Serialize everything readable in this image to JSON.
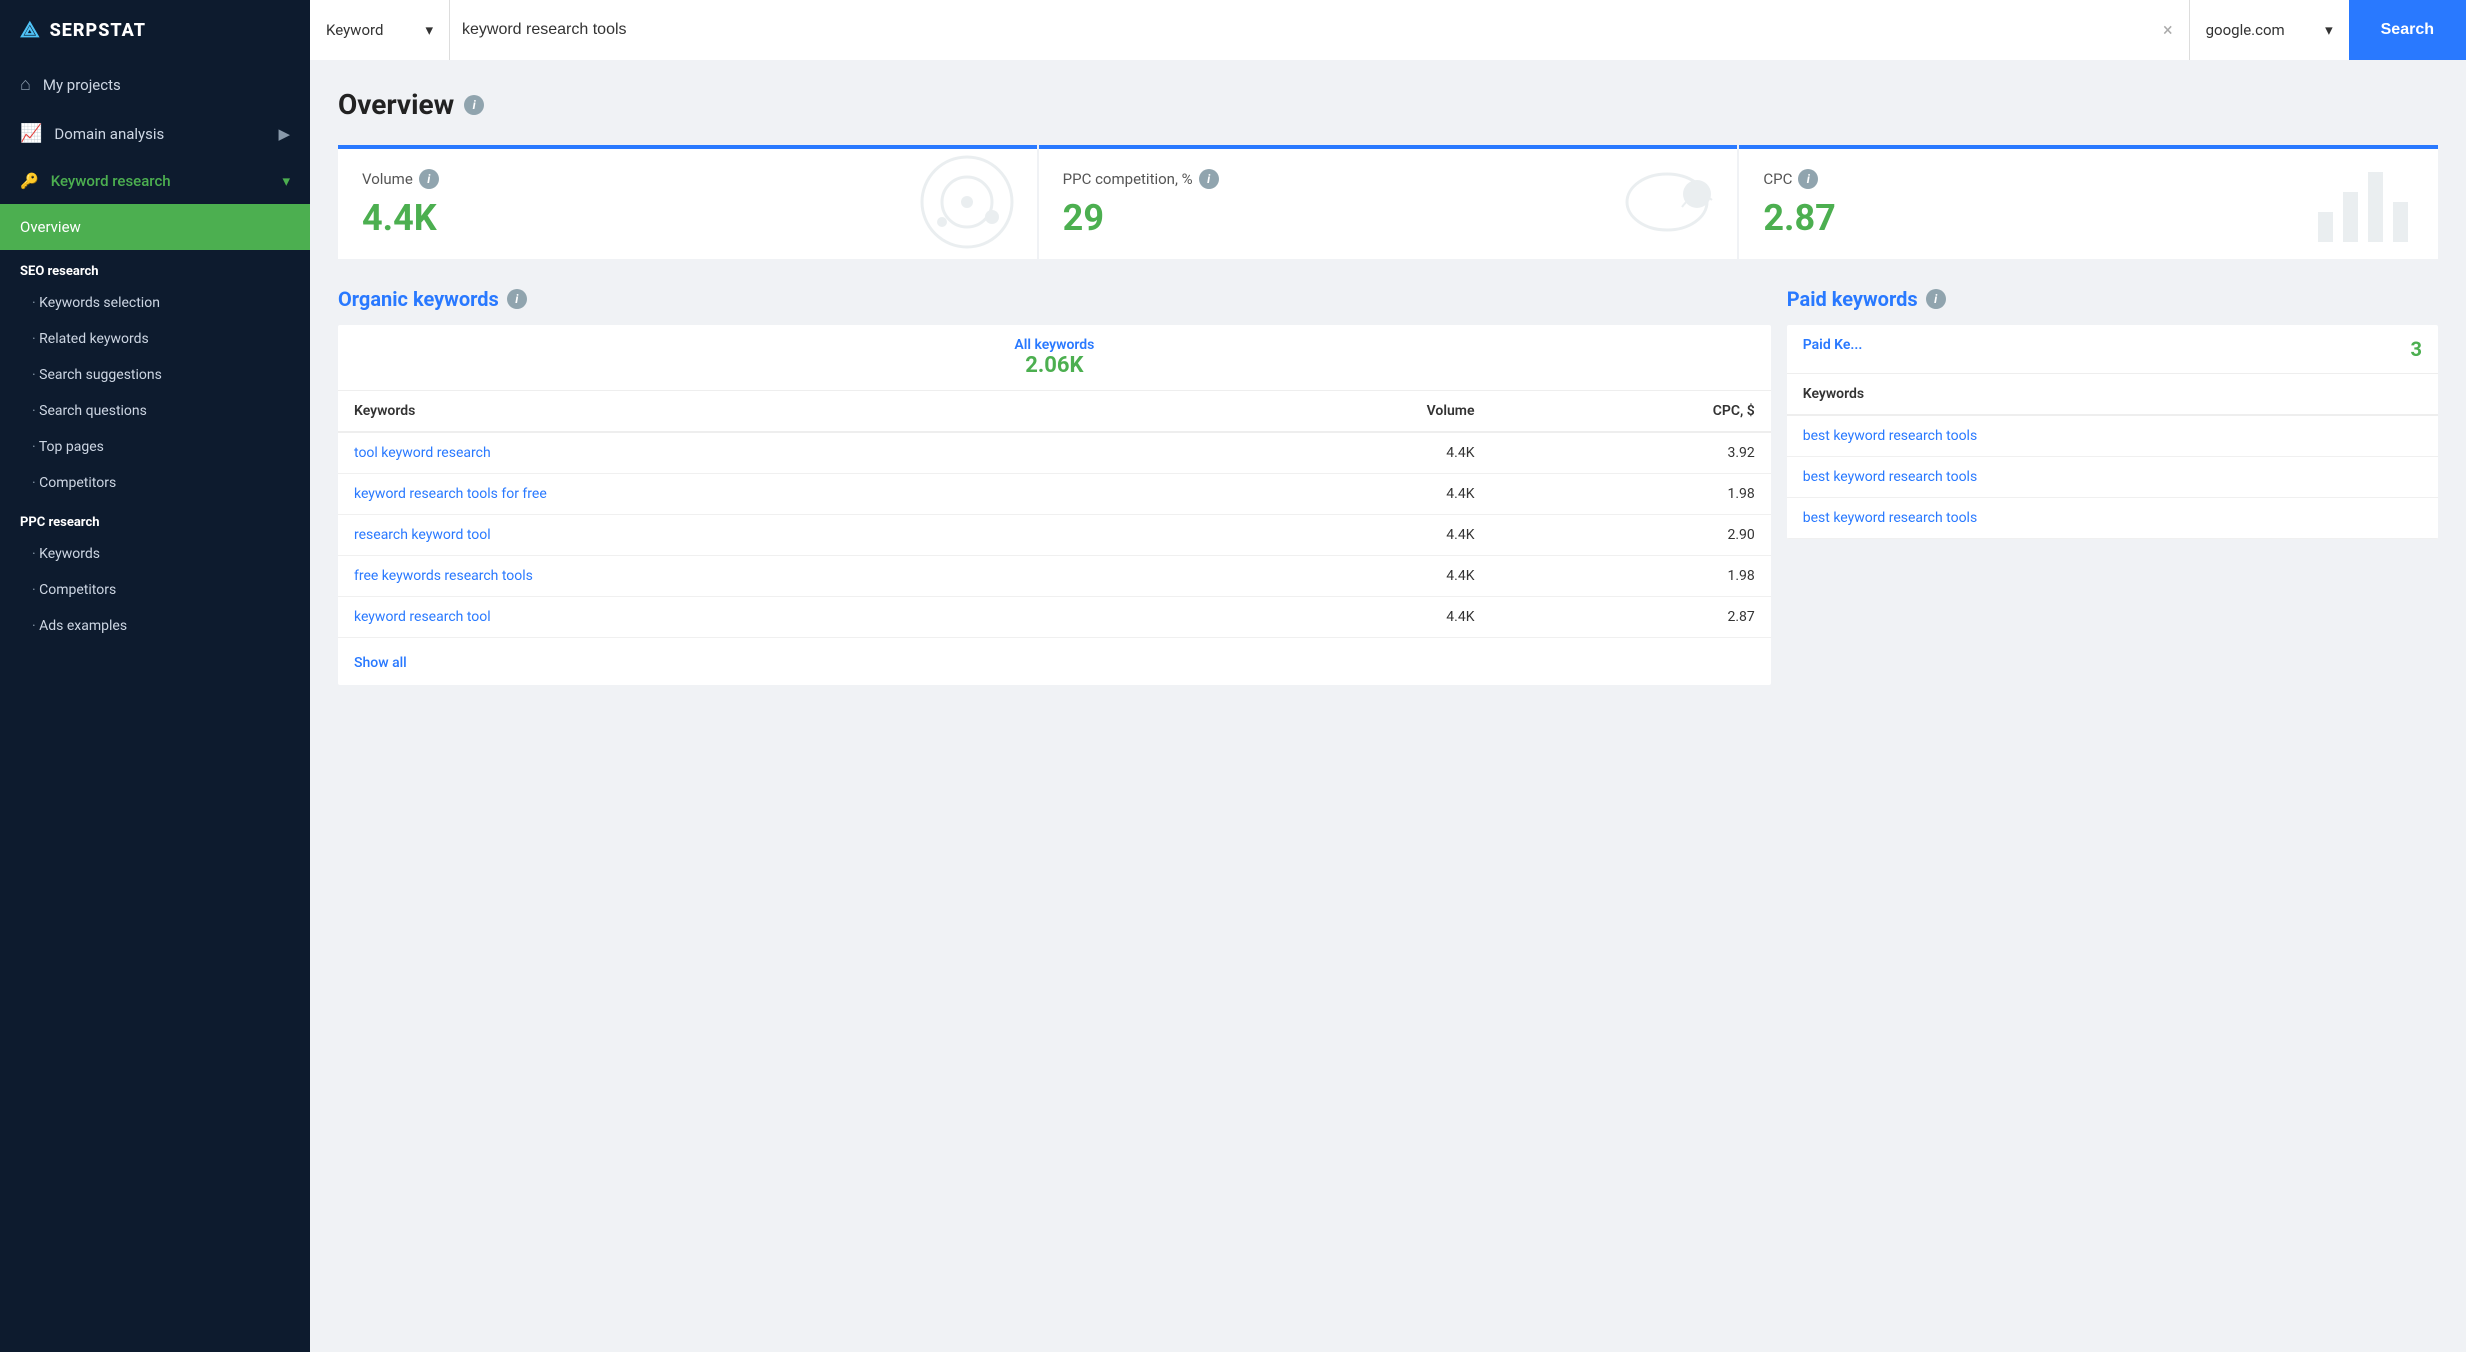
{
  "topbar": {
    "logo": "SERPSTAT",
    "search_type": "Keyword",
    "search_query": "keyword research tools",
    "engine": "google.com",
    "search_btn": "Search",
    "clear_icon": "×",
    "chevron": "▾"
  },
  "sidebar": {
    "items": [
      {
        "id": "my-projects",
        "label": "My projects",
        "icon": "⌂"
      },
      {
        "id": "domain-analysis",
        "label": "Domain analysis",
        "icon": "📊",
        "has_chevron": true
      },
      {
        "id": "keyword-research",
        "label": "Keyword research",
        "icon": "🔑",
        "active": true,
        "chevron": "▾"
      },
      {
        "id": "overview",
        "label": "Overview",
        "sub": false,
        "active_leaf": true
      }
    ],
    "seo_section": {
      "header": "SEO research",
      "items": [
        "Keywords selection",
        "Related keywords",
        "Search suggestions",
        "Search questions",
        "Top pages",
        "Competitors"
      ]
    },
    "ppc_section": {
      "header": "PPC research",
      "items": [
        "Keywords",
        "Competitors",
        "Ads examples"
      ]
    }
  },
  "content": {
    "page_title": "Overview",
    "stat_cards": [
      {
        "label": "Volume",
        "value": "4.4K"
      },
      {
        "label": "PPC competition, %",
        "value": "29"
      },
      {
        "label": "CPC",
        "value": "2.87"
      }
    ],
    "organic": {
      "section_title": "Organic keywords",
      "all_keywords_label": "All keywords",
      "all_keywords_count": "2.06K",
      "columns": [
        "Keywords",
        "Volume",
        "CPC, $"
      ],
      "rows": [
        {
          "keyword": "tool keyword research",
          "volume": "4.4K",
          "cpc": "3.92"
        },
        {
          "keyword": "keyword research tools for free",
          "volume": "4.4K",
          "cpc": "1.98"
        },
        {
          "keyword": "research keyword tool",
          "volume": "4.4K",
          "cpc": "2.90"
        },
        {
          "keyword": "free keywords research tools",
          "volume": "4.4K",
          "cpc": "1.98"
        },
        {
          "keyword": "keyword research tool",
          "volume": "4.4K",
          "cpc": "2.87"
        }
      ],
      "show_all": "Show all"
    },
    "paid": {
      "section_title": "Paid keywords",
      "paid_keywords_label": "Paid Ke...",
      "paid_count": "3",
      "columns": [
        "Keywords"
      ],
      "rows": [
        {
          "keyword": "best keyword research tools"
        },
        {
          "keyword": "best keyword research tools"
        },
        {
          "keyword": "best keyword research tools"
        }
      ]
    }
  }
}
